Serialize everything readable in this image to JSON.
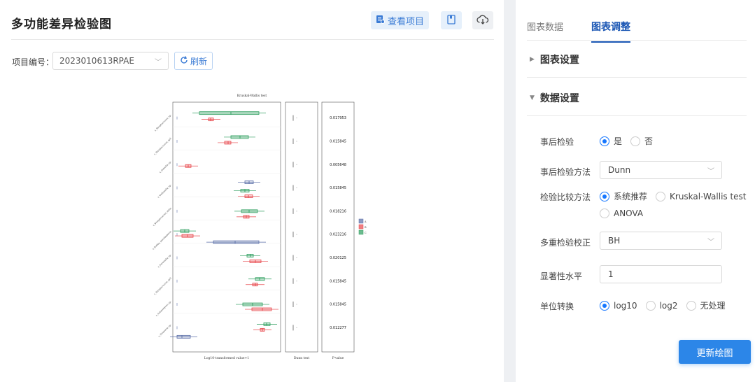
{
  "header": {
    "title": "多功能差异检验图",
    "view_project_label": "查看项目"
  },
  "project": {
    "label": "项目编号：",
    "value": "2023010613RPAE",
    "refresh_label": "刷新"
  },
  "right": {
    "tabs": [
      "图表数据",
      "图表调整"
    ],
    "chart_settings": "图表设置",
    "data_settings": "数据设置",
    "posthoc": {
      "label": "事后检验",
      "options": [
        "是",
        "否"
      ],
      "selected": "是"
    },
    "posthoc_method": {
      "label": "事后检验方法",
      "value": "Dunn"
    },
    "compare_method": {
      "label": "检验比较方法",
      "options": [
        "系统推荐",
        "Kruskal-Wallis test",
        "ANOVA"
      ],
      "selected": "系统推荐"
    },
    "correction": {
      "label": "多重检验校正",
      "value": "BH"
    },
    "alpha": {
      "label": "显著性水平",
      "value": "1"
    },
    "unit": {
      "label": "单位转换",
      "options": [
        "log10",
        "log2",
        "无处理"
      ],
      "selected": "log10"
    },
    "update_label": "更新绘图"
  },
  "chart_data": {
    "type": "box",
    "title": "Kruskal-Wallis test",
    "xlabel": "Log10-transformed value+1",
    "panel2_label": "Dunn test",
    "panel3_label": "P-value",
    "categories": [
      "s_Streptococcus_sp.",
      "s_Streptococcus_sp2",
      "s_Gemella_sp.",
      "s_Veillonella_sp.",
      "s_Streptococcus_mitis",
      "s_Rothia_mucilaginosa",
      "s_Prevotella_sp.",
      "s_Streptococcus_sp3",
      "s_Actinomyces_sp.",
      "s_Neisseria_sp."
    ],
    "pvalues": [
      "0.017953",
      "0.015845",
      "0.005648",
      "0.015845",
      "0.018216",
      "0.023216",
      "0.020125",
      "0.015845",
      "0.015845",
      "0.012277"
    ],
    "legend": [
      "A",
      "B",
      "C"
    ],
    "colors": {
      "A": "#5b6fa8",
      "B": "#e8474c",
      "C": "#2e9e5f"
    }
  }
}
